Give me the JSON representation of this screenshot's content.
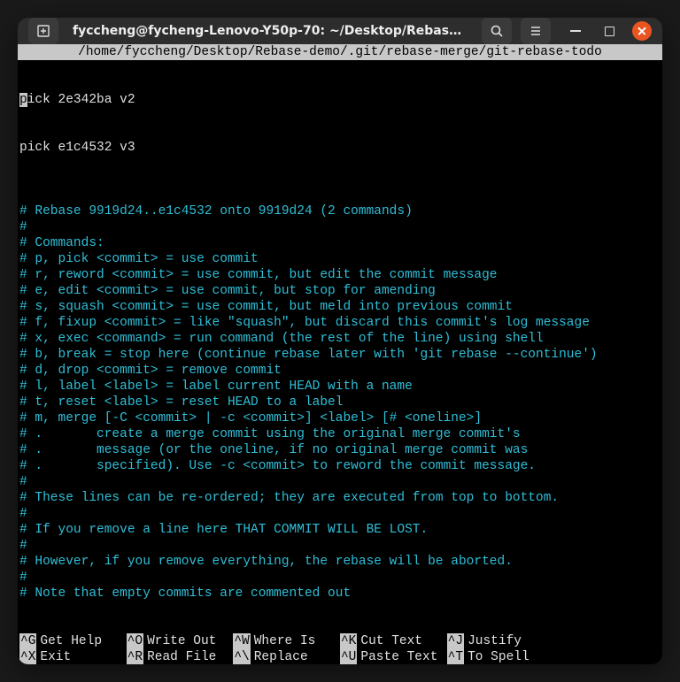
{
  "window": {
    "title": "fyccheng@fycheng-Lenovo-Y50p-70: ~/Desktop/Rebase-d..."
  },
  "editor": {
    "path": "/home/fyccheng/Desktop/Rebase-demo/.git/rebase-merge/git-rebase-todo",
    "pick_lines": [
      {
        "prefix": "p",
        "rest": "ick 2e342ba v2"
      },
      {
        "prefix": "",
        "rest": "pick e1c4532 v3"
      }
    ],
    "comment_lines": [
      "",
      "# Rebase 9919d24..e1c4532 onto 9919d24 (2 commands)",
      "#",
      "# Commands:",
      "# p, pick <commit> = use commit",
      "# r, reword <commit> = use commit, but edit the commit message",
      "# e, edit <commit> = use commit, but stop for amending",
      "# s, squash <commit> = use commit, but meld into previous commit",
      "# f, fixup <commit> = like \"squash\", but discard this commit's log message",
      "# x, exec <command> = run command (the rest of the line) using shell",
      "# b, break = stop here (continue rebase later with 'git rebase --continue')",
      "# d, drop <commit> = remove commit",
      "# l, label <label> = label current HEAD with a name",
      "# t, reset <label> = reset HEAD to a label",
      "# m, merge [-C <commit> | -c <commit>] <label> [# <oneline>]",
      "# .       create a merge commit using the original merge commit's",
      "# .       message (or the oneline, if no original merge commit was",
      "# .       specified). Use -c <commit> to reword the commit message.",
      "#",
      "# These lines can be re-ordered; they are executed from top to bottom.",
      "#",
      "# If you remove a line here THAT COMMIT WILL BE LOST.",
      "#",
      "# However, if you remove everything, the rebase will be aborted.",
      "#",
      "# Note that empty commits are commented out"
    ]
  },
  "shortcuts": {
    "row1": [
      {
        "key": "^G",
        "label": "Get Help"
      },
      {
        "key": "^O",
        "label": "Write Out"
      },
      {
        "key": "^W",
        "label": "Where Is"
      },
      {
        "key": "^K",
        "label": "Cut Text"
      },
      {
        "key": "^J",
        "label": "Justify"
      }
    ],
    "row2": [
      {
        "key": "^X",
        "label": "Exit"
      },
      {
        "key": "^R",
        "label": "Read File"
      },
      {
        "key": "^\\",
        "label": "Replace"
      },
      {
        "key": "^U",
        "label": "Paste Text"
      },
      {
        "key": "^T",
        "label": "To Spell"
      }
    ]
  }
}
